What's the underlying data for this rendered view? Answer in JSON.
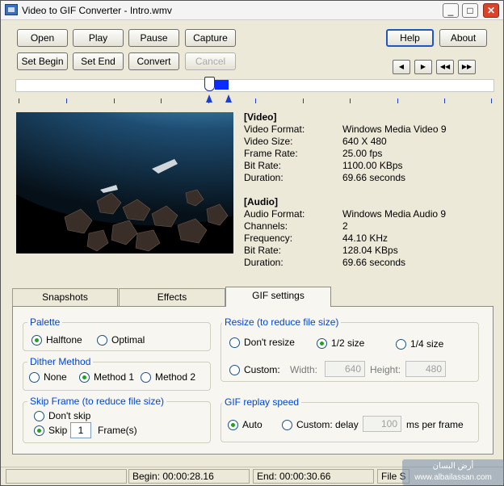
{
  "window": {
    "title": "Video to GIF Converter - Intro.wmv",
    "min": "_",
    "max": "□",
    "close": "✕"
  },
  "toolbar": {
    "open": "Open",
    "play": "Play",
    "pause": "Pause",
    "capture": "Capture",
    "set_begin": "Set Begin",
    "set_end": "Set End",
    "convert": "Convert",
    "cancel": "Cancel",
    "help": "Help",
    "about": "About",
    "nav_icons": [
      "prev-frame-icon",
      "next-frame-icon",
      "rewind-icon",
      "fast-forward-icon"
    ],
    "nav_glyphs": [
      "◀",
      "▶",
      "◀◀",
      "▶▶"
    ]
  },
  "video": {
    "header": "[Video]",
    "fields": [
      {
        "label": "Video Format:",
        "value": "Windows Media Video 9"
      },
      {
        "label": "Video Size:",
        "value": "640 X 480"
      },
      {
        "label": "Frame Rate:",
        "value": "25.00 fps"
      },
      {
        "label": "Bit Rate:",
        "value": "1100.00 KBps"
      },
      {
        "label": "Duration:",
        "value": "69.66 seconds"
      }
    ]
  },
  "audio": {
    "header": "[Audio]",
    "fields": [
      {
        "label": "Audio Format:",
        "value": "Windows Media Audio 9"
      },
      {
        "label": "Channels:",
        "value": "2"
      },
      {
        "label": "Frequency:",
        "value": "44.10 KHz"
      },
      {
        "label": "Bit Rate:",
        "value": "128.04 KBps"
      },
      {
        "label": "Duration:",
        "value": "69.66 seconds"
      }
    ]
  },
  "tabs": {
    "snapshots": "Snapshots",
    "effects": "Effects",
    "gif_settings": "GIF settings"
  },
  "palette": {
    "title": "Palette",
    "halftone": "Halftone",
    "optimal": "Optimal"
  },
  "dither": {
    "title": "Dither Method",
    "none": "None",
    "method1": "Method 1",
    "method2": "Method 2"
  },
  "skip": {
    "title": "Skip Frame (to reduce file size)",
    "dont_skip": "Don't skip",
    "skip": "Skip",
    "value": "1",
    "unit": "Frame(s)"
  },
  "resize": {
    "title": "Resize (to reduce file size)",
    "dont_resize": "Don't resize",
    "half": "1/2 size",
    "quarter": "1/4 size",
    "custom": "Custom:",
    "width_label": "Width:",
    "width": "640",
    "height_label": "Height:",
    "height": "480"
  },
  "replay": {
    "title": "GIF replay speed",
    "auto": "Auto",
    "custom": "Custom: delay",
    "delay": "100",
    "unit": "ms per frame"
  },
  "status": {
    "begin": "Begin: 00:00:28.16",
    "end": "End: 00:00:30.66",
    "size": "File S"
  },
  "watermark": {
    "line1": "أرض البسان",
    "line2": "www.albailassan.com"
  }
}
